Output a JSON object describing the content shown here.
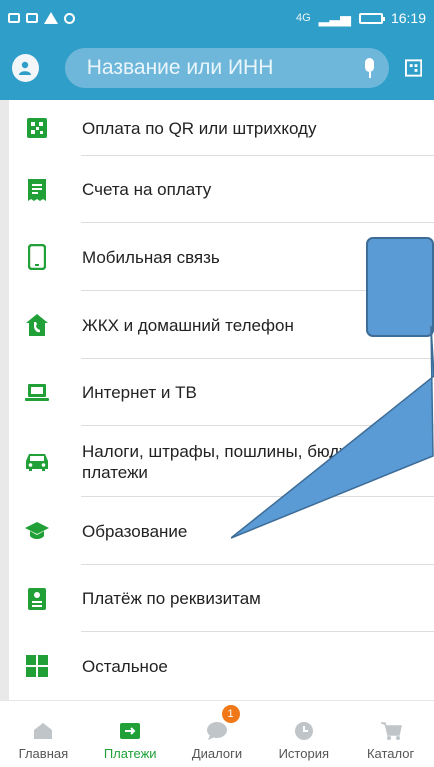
{
  "statusbar": {
    "network": "4G",
    "time": "16:19"
  },
  "search": {
    "placeholder": "Название или ИНН"
  },
  "payments": {
    "items": [
      {
        "label": "Оплата по QR или штрихкоду",
        "icon": "qr-code-icon"
      },
      {
        "label": "Счета на оплату",
        "icon": "invoice-icon"
      },
      {
        "label": "Мобильная связь",
        "icon": "mobile-phone-icon"
      },
      {
        "label": "ЖКХ и домашний телефон",
        "icon": "house-phone-icon"
      },
      {
        "label": "Интернет и ТВ",
        "icon": "laptop-icon"
      },
      {
        "label_line1": "Налоги, штрафы, пошлины, бюджетные",
        "label_line2": "платежи",
        "icon": "car-icon"
      },
      {
        "label": "Образование",
        "icon": "graduation-cap-icon"
      },
      {
        "label": "Платёж по реквизитам",
        "icon": "document-icon"
      },
      {
        "label": "Остальное",
        "icon": "grid-icon"
      }
    ]
  },
  "tabs": [
    {
      "label": "Главная",
      "icon": "home-icon"
    },
    {
      "label": "Платежи",
      "icon": "transfer-arrow-icon"
    },
    {
      "label": "Диалоги",
      "icon": "chat-icon",
      "badge": "1"
    },
    {
      "label": "История",
      "icon": "clock-icon"
    },
    {
      "label": "Каталог",
      "icon": "cart-icon"
    }
  ],
  "colors": {
    "header": "#2f9ec9",
    "accent_green": "#21a038",
    "badge": "#f07818",
    "callout_fill": "#5b9bd5",
    "callout_stroke": "#3d6c97"
  }
}
